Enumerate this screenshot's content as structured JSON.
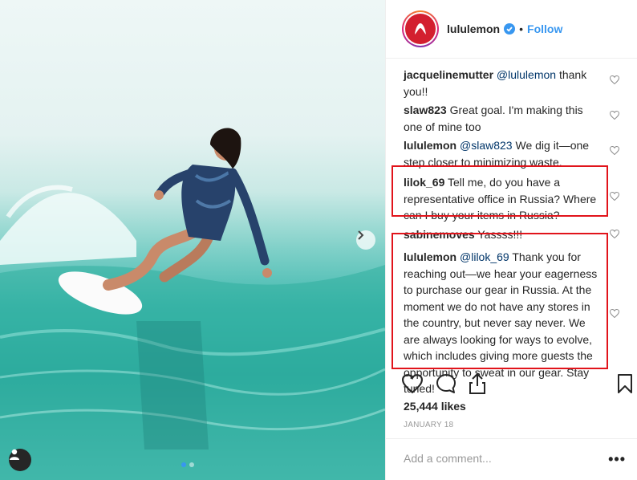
{
  "post": {
    "username": "lululemon",
    "separator": "•",
    "follow_label": "Follow",
    "likes": "25,444 likes",
    "date": "JANUARY 18",
    "add_comment_placeholder": "Add a comment...",
    "more_label": "•••"
  },
  "comments": [
    {
      "user": "jacquelinemutter",
      "mention": "@lululemon",
      "text": " thank you!!"
    },
    {
      "user": "slaw823",
      "mention": "",
      "text": "Great goal. I'm making this one of mine too"
    },
    {
      "user": "lululemon",
      "mention": "@slaw823",
      "text": " We dig it—one step closer to minimizing waste."
    },
    {
      "user": "lilok_69",
      "mention": "",
      "text": "Tell me, do you have a representative office in Russia? Where can I buy your items in Russia?"
    },
    {
      "user": "sabinemoves",
      "mention": "",
      "text": "Yassss!!!"
    },
    {
      "user": "lululemon",
      "mention": "@lilok_69",
      "text": " Thank you for reaching out—we hear your eagerness to purchase our gear in Russia. At the moment we do not have any stores in the country, but never say never. We are always looking for ways to evolve, which includes giving more guests the opportunity to sweat in our gear. Stay tuned!"
    }
  ],
  "colors": {
    "accent": "#3897f0",
    "brand": "#d31f2f",
    "highlight": "#e1141b"
  }
}
